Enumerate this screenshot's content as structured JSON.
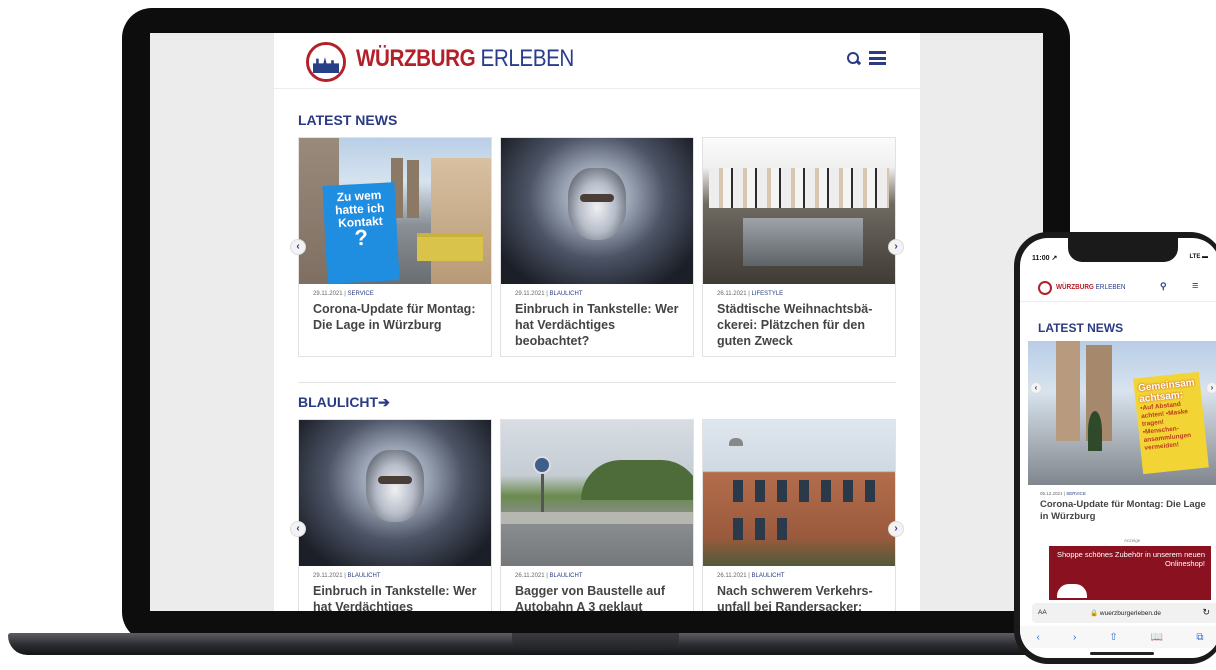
{
  "site": {
    "logo_bold": "WÜRZBURG",
    "logo_thin": "ERLEBEN"
  },
  "latest_news": {
    "heading": "LATEST NEWS",
    "cards": [
      {
        "date": "29.11.2021",
        "category": "SERVICE",
        "title": "Corona-Update für Montag: Die Lage in Würzburg"
      },
      {
        "date": "29.11.2021",
        "category": "BLAULICHT",
        "title": "Einbruch in Tankstelle: Wer hat Verdächtiges beobachtet?"
      },
      {
        "date": "26.11.2021",
        "category": "LIFESTYLE",
        "title": "Städtische Weihnachtsbä­ckerei: Plätzchen für den guten Zweck"
      }
    ],
    "sign_text": "Zu wem hatte ich Kontakt",
    "sign_q": "?"
  },
  "blaulicht": {
    "heading": "BLAULICHT",
    "arrow": "➔",
    "cards": [
      {
        "date": "29.11.2021",
        "category": "BLAULICHT",
        "title": "Einbruch in Tankstelle: Wer hat Verdächtiges"
      },
      {
        "date": "26.11.2021",
        "category": "BLAULICHT",
        "title": "Bagger von Baustelle auf Autobahn A 3 geklaut"
      },
      {
        "date": "26.11.2021",
        "category": "BLAULICHT",
        "title": "Nach schwerem Verkehrs­unfall bei Randersacker:"
      }
    ]
  },
  "carousel": {
    "prev": "‹",
    "next": "›"
  },
  "phone": {
    "time": "11:00 ↗",
    "status": "LTE ▬",
    "logo_bold": "WÜRZBURG",
    "logo_thin": "ERLEBEN",
    "search_icon": "search-icon",
    "menu_icon": "menu-icon",
    "section": "LATEST NEWS",
    "sign_big": "Gemeinsam achtsam:",
    "sign_lines": "•Auf Abstand achten! •Maske tragen! •Menschen-ansammlungen vermeiden!",
    "date": "06.12.2021",
    "category": "SERVICE",
    "title": "Corona-Update für Montag: Die Lage in Würzburg",
    "ad_label": "Anzeige",
    "ad_text": "Shoppe schönes Zubehör in unserem neuen Onlineshop!",
    "url_aa": "AA",
    "url": "🔒 wuerzburgerleben.de",
    "reload": "↻",
    "toolbar": [
      "‹",
      "›",
      "⇧",
      "📖",
      "⧉"
    ]
  },
  "colors": {
    "brand_red": "#b3202a",
    "brand_blue": "#2a3b83"
  }
}
